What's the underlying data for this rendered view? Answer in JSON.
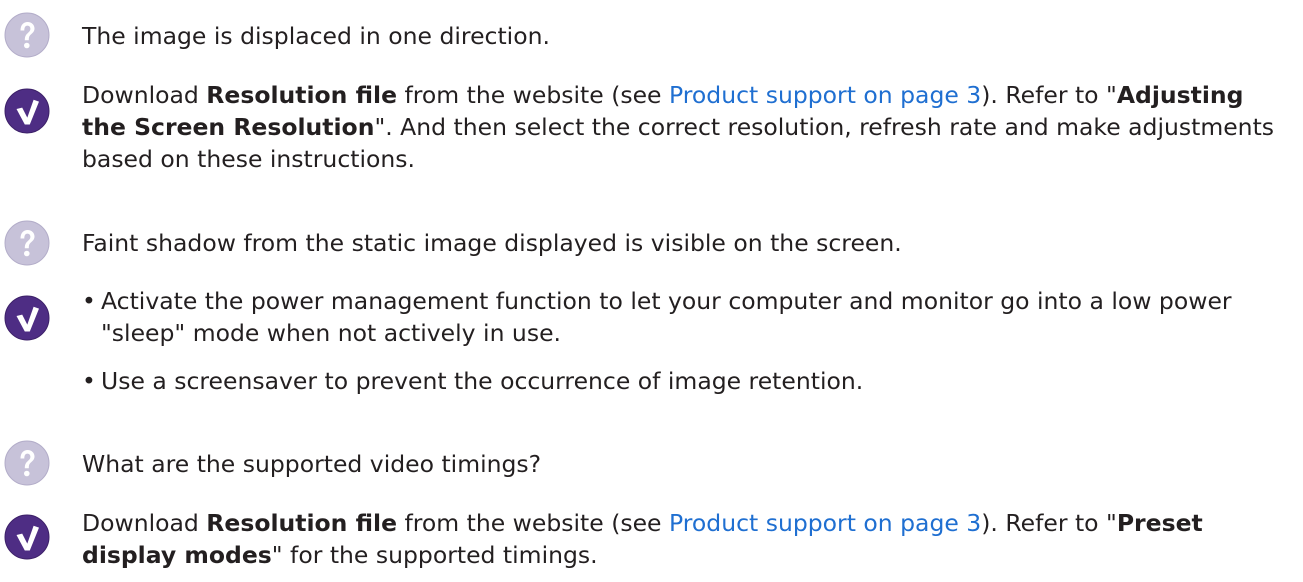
{
  "faq": [
    {
      "question": "The image is displaced in one direction.",
      "answer": {
        "part1": "Download ",
        "bold1": "Resolution file",
        "part2": " from the website (see ",
        "link": "Product support on page 3",
        "part3": "). Refer to \"",
        "bold2": "Adjusting the Screen Resolution",
        "part4": "\". And then select the correct resolution, refresh rate and make adjustments based on these instructions."
      }
    },
    {
      "question": "Faint shadow from the static image displayed is visible on the screen.",
      "answer": {
        "bullet_char": "•",
        "bullets": [
          "Activate the power management function to let your computer and monitor go into a low power \"sleep\" mode when not actively in use.",
          "Use a screensaver to prevent the occurrence of image retention."
        ]
      }
    },
    {
      "question": "What are the supported video timings?",
      "answer": {
        "part1": "Download ",
        "bold1": "Resolution file",
        "part2": " from the website (see ",
        "link": "Product support on page 3",
        "part3": "). Refer to \"",
        "bold2": "Preset display modes",
        "part4": "\" for the supported timings."
      }
    }
  ],
  "icons": {
    "question_icon": "question-mark-icon",
    "answer_icon": "checkmark-icon",
    "question_color": "#c7c2d9",
    "answer_color": "#4e2d84",
    "link_color": "#1f6fd1"
  }
}
